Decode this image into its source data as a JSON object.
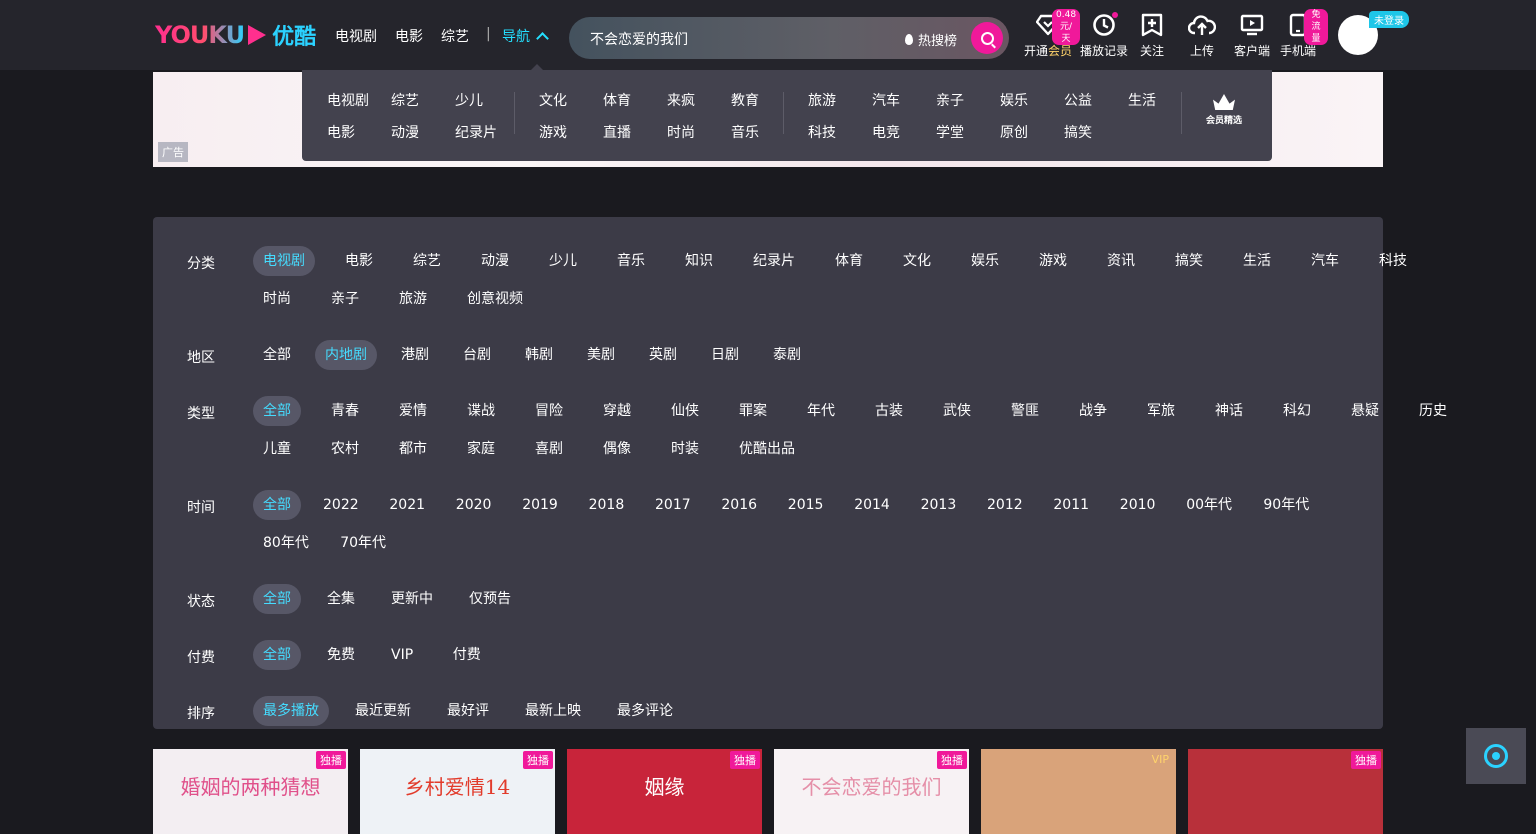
{
  "header": {
    "logo_text": "YOUKU",
    "logo_cn": "优酷",
    "nav": [
      "电视剧",
      "电影",
      "综艺"
    ],
    "separator": "|",
    "guide_label": "导航",
    "search_value": "不会恋爱的我们",
    "hot_rank_label": "热搜榜",
    "icons": [
      {
        "name": "vip-diamond-icon",
        "label_prefix": "开通",
        "label_vip": "会员",
        "badge": "0.48元/天"
      },
      {
        "name": "history-clock-icon",
        "label": "播放记录"
      },
      {
        "name": "follow-add-icon",
        "label": "关注"
      },
      {
        "name": "upload-cloud-icon",
        "label": "上传"
      },
      {
        "name": "desktop-client-icon",
        "label": "客户端"
      },
      {
        "name": "mobile-phone-icon",
        "label": "手机端",
        "badge": "免流量"
      }
    ],
    "login_badge": "未登录"
  },
  "banner": {
    "ad_label": "广告"
  },
  "dropdown": {
    "group1": [
      [
        "电视剧",
        "综艺",
        "少儿"
      ],
      [
        "电影",
        "动漫",
        "纪录片"
      ]
    ],
    "group2": [
      [
        "文化",
        "体育",
        "来疯",
        "教育"
      ],
      [
        "游戏",
        "直播",
        "时尚",
        "音乐"
      ]
    ],
    "group3": [
      [
        "旅游",
        "汽车",
        "亲子",
        "娱乐",
        "公益",
        "生活"
      ],
      [
        "科技",
        "电竞",
        "学堂",
        "原创",
        "搞笑"
      ]
    ],
    "member_label": "会员精选"
  },
  "filters": {
    "category": {
      "label": "分类",
      "line1": [
        "电视剧",
        "电影",
        "综艺",
        "动漫",
        "少儿",
        "音乐",
        "知识",
        "纪录片",
        "体育",
        "文化",
        "娱乐",
        "游戏",
        "资讯",
        "搞笑",
        "生活",
        "汽车",
        "科技"
      ],
      "line2": [
        "时尚",
        "亲子",
        "旅游",
        "创意视频"
      ],
      "selected": "电视剧"
    },
    "region": {
      "label": "地区",
      "line1": [
        "全部",
        "内地剧",
        "港剧",
        "台剧",
        "韩剧",
        "美剧",
        "英剧",
        "日剧",
        "泰剧"
      ],
      "selected": "内地剧"
    },
    "genre": {
      "label": "类型",
      "line1": [
        "全部",
        "青春",
        "爱情",
        "谍战",
        "冒险",
        "穿越",
        "仙侠",
        "罪案",
        "年代",
        "古装",
        "武侠",
        "警匪",
        "战争",
        "军旅",
        "神话",
        "科幻",
        "悬疑",
        "历史"
      ],
      "line2": [
        "儿童",
        "农村",
        "都市",
        "家庭",
        "喜剧",
        "偶像",
        "时装",
        "优酷出品"
      ],
      "selected": "全部"
    },
    "year": {
      "label": "时间",
      "line1": [
        "全部",
        "2022",
        "2021",
        "2020",
        "2019",
        "2018",
        "2017",
        "2016",
        "2015",
        "2014",
        "2013",
        "2012",
        "2011",
        "2010",
        "00年代",
        "90年代"
      ],
      "line2": [
        "80年代",
        "70年代"
      ],
      "selected": "全部"
    },
    "status": {
      "label": "状态",
      "line1": [
        "全部",
        "全集",
        "更新中",
        "仅预告"
      ],
      "selected": "全部"
    },
    "payment": {
      "label": "付费",
      "line1": [
        "全部",
        "免费",
        "VIP",
        "付费"
      ],
      "selected": "全部"
    },
    "sort": {
      "label": "排序",
      "line1": [
        "最多播放",
        "最近更新",
        "最好评",
        "最新上映",
        "最多评论"
      ],
      "selected": "最多播放"
    }
  },
  "cards": [
    {
      "tag": "独播",
      "title": "婚姻的两种猜想",
      "bg": "#f3eef2",
      "fg": "#e0508a"
    },
    {
      "tag": "独播",
      "title": "乡村爱情14",
      "bg": "#eef2f6",
      "fg": "#e23b2b"
    },
    {
      "tag": "独播",
      "title": "姻缘",
      "bg": "#c8243a",
      "fg": "#ffffff"
    },
    {
      "tag": "独播",
      "title": "不会恋爱的我们",
      "bg": "#f7f2f4",
      "fg": "#e58fa8"
    },
    {
      "tag": "VIP",
      "title": "",
      "bg": "#d9a37a",
      "fg": "#ffffff"
    },
    {
      "tag": "独播",
      "title": "",
      "bg": "#b8303a",
      "fg": "#ffffff"
    }
  ],
  "colors": {
    "accent_cyan": "#24e0ff",
    "accent_pink": "#f0199a",
    "panel": "#3c3b47",
    "dropdown": "#43424e"
  }
}
